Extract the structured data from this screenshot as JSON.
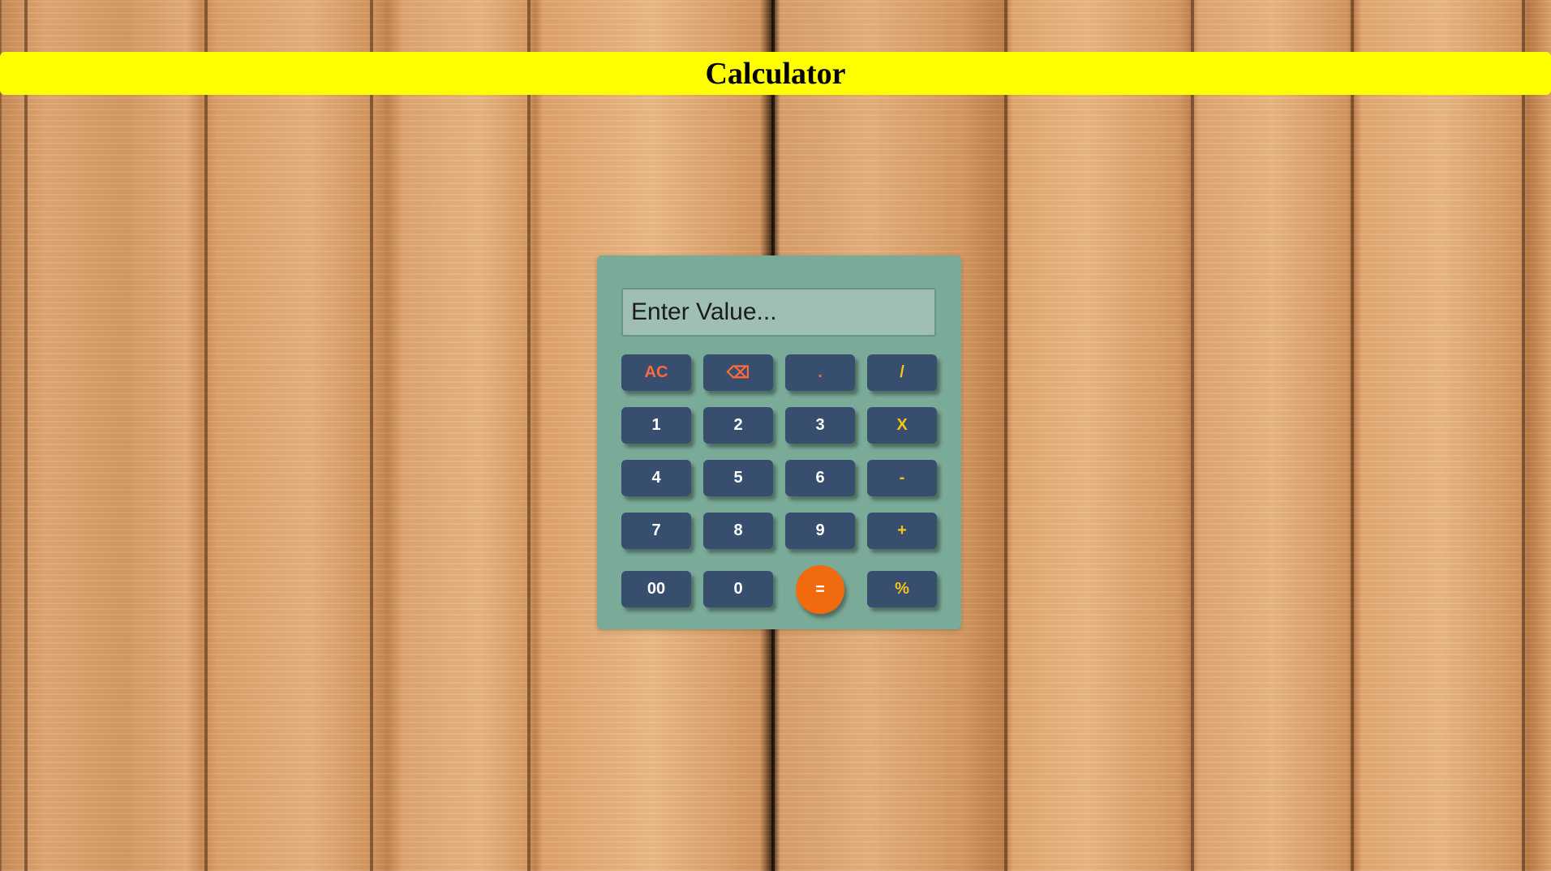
{
  "header": {
    "title": "Calculator",
    "bar_color": "#ffff00"
  },
  "calculator": {
    "display": {
      "value": "",
      "placeholder": "Enter Value..."
    },
    "keys": {
      "ac": "AC",
      "backspace": "⌫",
      "dot": ".",
      "divide": "/",
      "one": "1",
      "two": "2",
      "three": "3",
      "multiply": "X",
      "four": "4",
      "five": "5",
      "six": "6",
      "minus": "-",
      "seven": "7",
      "eight": "8",
      "nine": "9",
      "plus": "+",
      "double_zero": "00",
      "zero": "0",
      "equals": "=",
      "percent": "%"
    },
    "colors": {
      "body": "#7aaa98",
      "key": "#374e6e",
      "operator_text": "#f5c518",
      "clear_text": "#ff6a3d",
      "equals": "#f26a0e"
    }
  }
}
